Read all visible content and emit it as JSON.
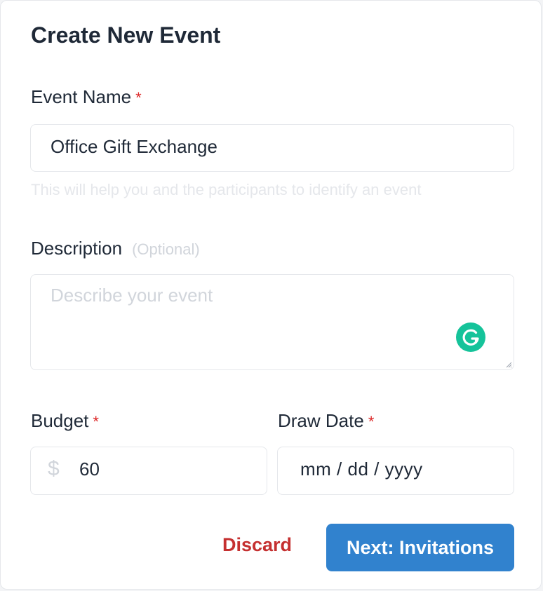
{
  "form": {
    "title": "Create New Event",
    "event_name": {
      "label": "Event Name",
      "required_mark": "*",
      "value": "Office Gift Exchange",
      "help": "This will help you and the participants to identify an event"
    },
    "description": {
      "label": "Description",
      "optional_text": "(Optional)",
      "placeholder": "Describe your event"
    },
    "budget": {
      "label": "Budget",
      "required_mark": "*",
      "currency": "$",
      "value": "60"
    },
    "draw_date": {
      "label": "Draw Date",
      "required_mark": "*",
      "placeholder": "mm / dd / yyyy"
    },
    "actions": {
      "discard_label": "Discard",
      "next_label": "Next: Invitations"
    }
  },
  "icons": {
    "grammarly": "grammarly-icon",
    "resize": "resize-handle-icon"
  },
  "colors": {
    "primary": "#3182ce",
    "danger": "#c53030",
    "required": "#dc2626",
    "grammarly": "#15c39a"
  }
}
